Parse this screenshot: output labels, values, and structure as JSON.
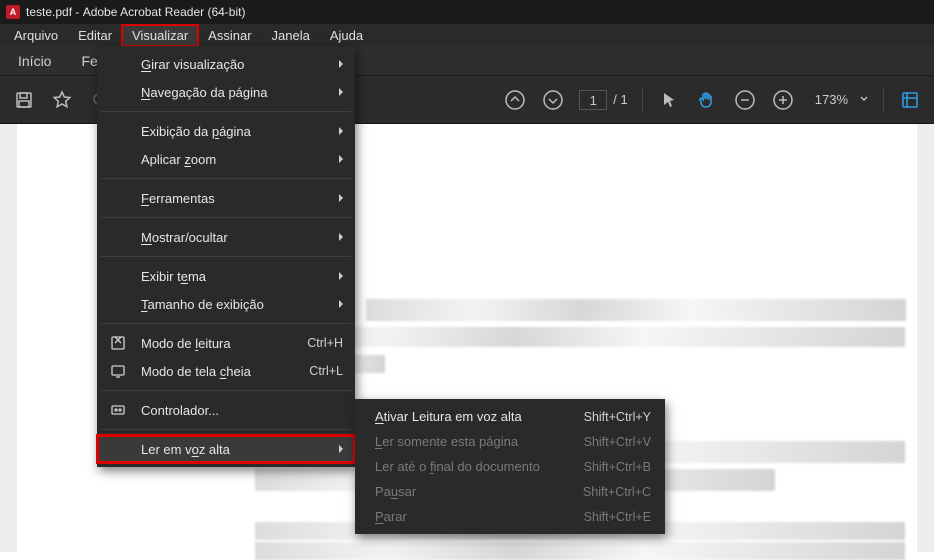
{
  "titlebar": {
    "filename": "teste.pdf",
    "appname": "Adobe Acrobat Reader (64-bit)"
  },
  "menubar": {
    "items": [
      {
        "label": "Arquivo"
      },
      {
        "label": "Editar"
      },
      {
        "label": "Visualizar",
        "active": true
      },
      {
        "label": "Assinar"
      },
      {
        "label": "Janela"
      },
      {
        "label": "Ajuda"
      }
    ]
  },
  "tabbar": {
    "home": "Início",
    "tools_prefix": "Fe"
  },
  "toolbar": {
    "page_current": "1",
    "page_total": "/ 1",
    "zoom_pct": "173%"
  },
  "dropdown": {
    "rotate": "Girar visualização",
    "nav": "Navegação da página",
    "pageview": "Exibição da página",
    "zoom": "Aplicar zoom",
    "tools": "Ferramentas",
    "showhide": "Mostrar/ocultar",
    "theme": "Exibir tema",
    "size": "Tamanho de exibição",
    "readmode": "Modo de leitura",
    "readmode_sc": "Ctrl+H",
    "fullscreen": "Modo de tela cheia",
    "fullscreen_sc": "Ctrl+L",
    "controller": "Controlador...",
    "readaloud": "Ler em voz alta"
  },
  "submenu": {
    "activate": "Ativar Leitura em voz alta",
    "activate_sc": "Shift+Ctrl+Y",
    "thispage": "Ler somente esta página",
    "thispage_sc": "Shift+Ctrl+V",
    "toend": "Ler até o final do documento",
    "toend_sc": "Shift+Ctrl+B",
    "pause": "Pausar",
    "pause_sc": "Shift+Ctrl+C",
    "stop": "Parar",
    "stop_sc": "Shift+Ctrl+E"
  }
}
